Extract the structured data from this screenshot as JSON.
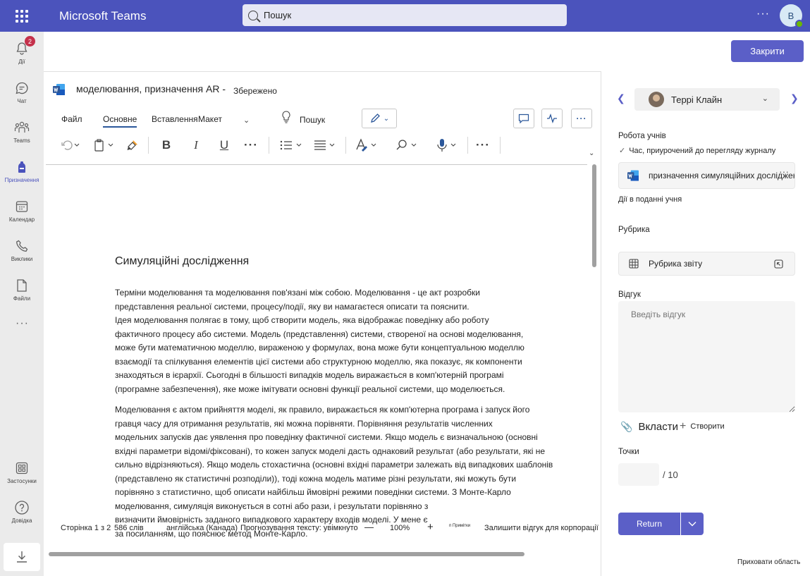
{
  "app": {
    "title": "Microsoft Teams",
    "search_placeholder": "Пошук",
    "more": "···",
    "user_initial": "В"
  },
  "rail": {
    "items": [
      {
        "label": "Дії",
        "badge": "2"
      },
      {
        "label": "Чат"
      },
      {
        "label": "Teams"
      },
      {
        "label": "Призначення"
      },
      {
        "label": "Календар"
      },
      {
        "label": "Виклики"
      },
      {
        "label": "Файли"
      }
    ],
    "more": "···",
    "apps_label": "Застосунки",
    "help_label": "Довідка"
  },
  "header": {
    "close_label": "Закрити"
  },
  "doc": {
    "title": "моделювання, призначення AR -",
    "saved": "Збережено",
    "tabs": [
      "Файл",
      "Основне",
      "Вставлення",
      "Макет"
    ],
    "tellme": "Пошук",
    "heading": "Симуляційні дослідження",
    "para1": "Терміни моделювання та моделювання пов'язані між собою. Моделювання - це акт розробки\nпредставлення реальної системи, процесу/події, яку ви намагаєтеся описати та пояснити.\nІдея моделювання полягає в тому, щоб створити модель, яка відображає поведінку або роботу\nфактичного процесу або системи. Модель (представлення) системи, створеної на основі моделювання,\nможе бути математичною моделлю, вираженою у формулах, вона може бути концептуальною моделлю\nвзаємодії та спілкування елементів цієї системи або структурною моделлю, яка показує, як компоненти\nзнаходяться в ієрархії. Сьогодні в більшості випадків модель виражається в комп'ютерній програмі\n(програмне забезпечення), яке може імітувати основні функції реальної системи, що моделюється.",
    "para2": "Моделювання є актом прийняття моделі, як правило, виражається як комп'ютерна програма і запуск його\nгравця часу для отримання результатів, які можна порівняти. Порівняння результатів численних\nмодельних запусків дає уявлення про поведінку фактичної системи. Якщо модель є визначальною (основні\nвхідні параметри відомі/фіксовані), то кожен запуск моделі дасть однаковий результат (або результати, які не\nсильно відрізняються). Якщо модель стохастична (основні вхідні параметри залежать від випадкових шаблонів\n(представлено як статистичні розподіли)), тоді кожна модель матиме різні результати, які можуть бути\nпорівняно з статистично, щоб описати найбільш ймовірні режими поведінки системи. З Монте-Карло\nмоделювання, симуляція виконується в сотні або рази, і результати порівняно з\nвизначити ймовірність заданого випадкового характеру входів моделі. У мене є\nза посиланням, що пояснює метод Монте-Карло."
  },
  "status": {
    "page": "Сторінка 1 з 2",
    "words": "586  слів",
    "language": "англійська (Канада)",
    "prediction": "Прогнозування тексту: увімкнуто",
    "zoom": "100%",
    "minus": "—",
    "plus": "+",
    "notes": "п Примітки",
    "feedback": "Залишити відгук для корпорації Майкрософт"
  },
  "panel": {
    "student_name": "Террі Клайн",
    "student_work_label": "Робота учнів",
    "turned_in_note": "Час, приурочений до перегляду журналу",
    "file_name": "призначення симуляційних досліджень",
    "file_more": "···",
    "activity_label": "Дії в поданні учня",
    "rubric_label": "Рубрика",
    "rubric_name": "Рубрика звіту",
    "feedback_label": "Відгук",
    "feedback_placeholder": "Введіть відгук",
    "attach_label": "Вкласти",
    "create_label": "Створити",
    "points_label": "Точки",
    "points_max": "/ 10",
    "return_label": "Return",
    "hide_pane": "Приховати область"
  },
  "colors": {
    "brand": "#4b53bc",
    "accent": "#5b5fc7",
    "word": "#2b579a"
  }
}
